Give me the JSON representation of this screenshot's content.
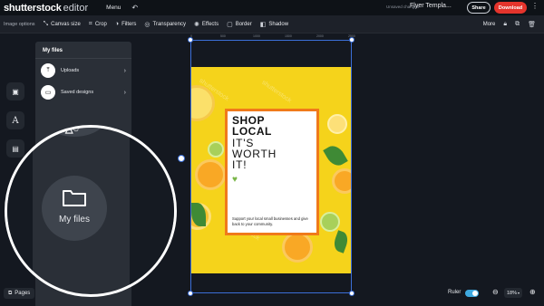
{
  "topbar": {
    "logo": "shutterstock",
    "logo_suffix": "editor",
    "menu_label": "Menu",
    "unsaved_label": "Unsaved changes",
    "doc_title": "Flyer Templa...",
    "share_label": "Share",
    "download_label": "Download",
    "download_color": "#e5342c"
  },
  "toolbar": {
    "label": "Image options",
    "items": [
      {
        "label": "Canvas size",
        "icon": "resize-icon"
      },
      {
        "label": "Crop",
        "icon": "crop-icon"
      },
      {
        "label": "Filters",
        "icon": "filters-icon"
      },
      {
        "label": "Transparency",
        "icon": "transparency-icon"
      },
      {
        "label": "Effects",
        "icon": "effects-icon"
      },
      {
        "label": "Border",
        "icon": "border-icon"
      },
      {
        "label": "Shadow",
        "icon": "shadow-icon"
      }
    ],
    "more_label": "More"
  },
  "ruler": {
    "ticks": [
      "0",
      "500",
      "1000",
      "1500",
      "2000",
      "2500"
    ]
  },
  "panel": {
    "title": "My files",
    "rows": [
      {
        "label": "Uploads",
        "icon": "upload-icon"
      },
      {
        "label": "Saved designs",
        "icon": "saved-icon"
      }
    ]
  },
  "magnifier": {
    "label": "My files",
    "icon": "folder-icon"
  },
  "flyer": {
    "headline_bold": [
      "SHOP",
      "LOCAL"
    ],
    "headline_light": [
      "IT'S",
      "WORTH",
      "IT!"
    ],
    "heart": "♥",
    "body": "Support your local small businesses and give back to your community.",
    "watermark": "shutterstock",
    "background_color": "#f5d31b",
    "border_color": "#f07a1a"
  },
  "bottom": {
    "pages_label": "Pages",
    "ruler_label": "Ruler",
    "ruler_on": true,
    "zoom_value": "18%"
  }
}
